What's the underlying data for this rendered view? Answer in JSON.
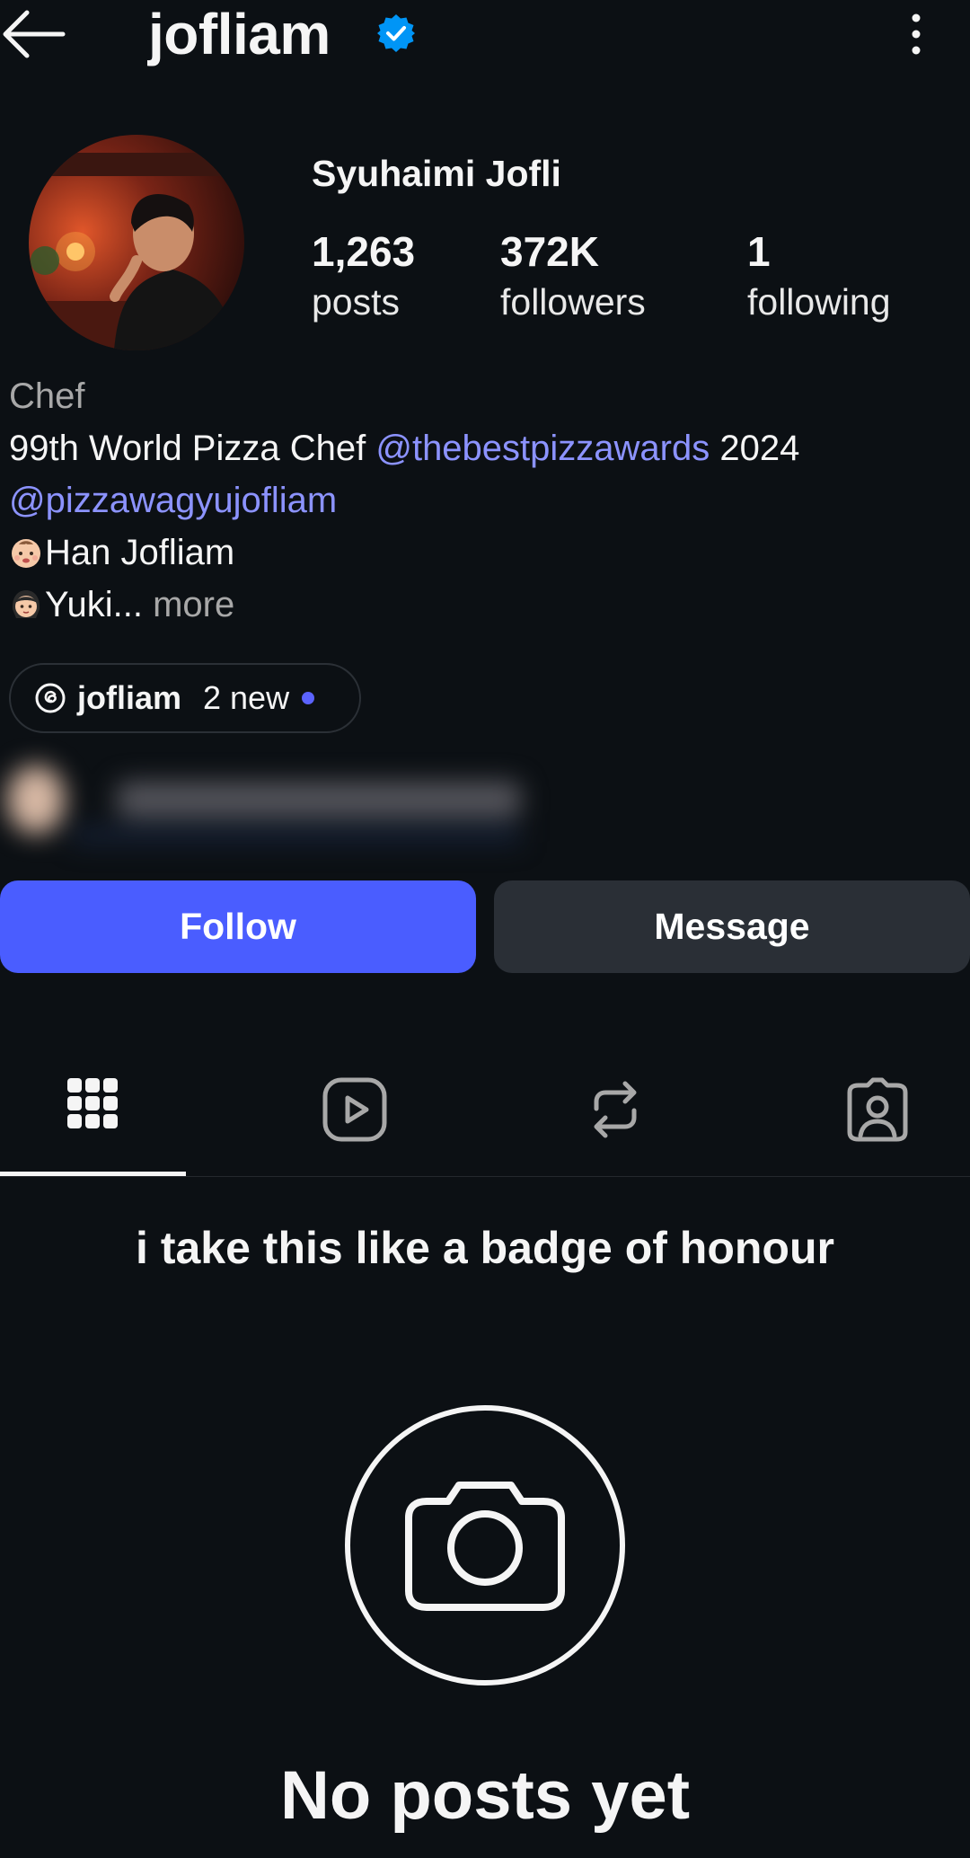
{
  "header": {
    "username": "jofliam",
    "back_icon": "arrow-left-icon",
    "verified_icon": "verified-badge-icon",
    "more_icon": "more-vertical-icon"
  },
  "profile": {
    "display_name": "Syuhaimi Jofli",
    "stats": [
      {
        "number": "1,263",
        "label": "posts"
      },
      {
        "number": "372K",
        "label": "followers"
      },
      {
        "number": "1",
        "label": "following"
      }
    ]
  },
  "bio": {
    "category": "Chef",
    "line1_text": "99th World Pizza Chef ",
    "line1_mention": "@thebestpizzawards",
    "line1_suffix": " 2024",
    "line2_mention": "@pizzawagyujofliam",
    "line3_text": "Han Jofliam",
    "line4_text": "Yuki...",
    "more_label": " more"
  },
  "threads": {
    "handle": "jofliam",
    "new_label": "2 new",
    "icon": "threads-icon"
  },
  "buttons": {
    "follow": "Follow",
    "message": "Message"
  },
  "tabs": [
    {
      "icon": "grid-icon",
      "active": true
    },
    {
      "icon": "reels-icon",
      "active": false
    },
    {
      "icon": "repost-icon",
      "active": false
    },
    {
      "icon": "tagged-icon",
      "active": false
    }
  ],
  "caption": "i take this like a badge of honour",
  "empty_state": {
    "icon": "camera-icon",
    "title": "No posts yet"
  },
  "colors": {
    "background": "#0c1014",
    "follow_button": "#4a5dff",
    "message_button": "#2a2f36",
    "mention": "#8c93ff",
    "verified": "#0095f6"
  }
}
